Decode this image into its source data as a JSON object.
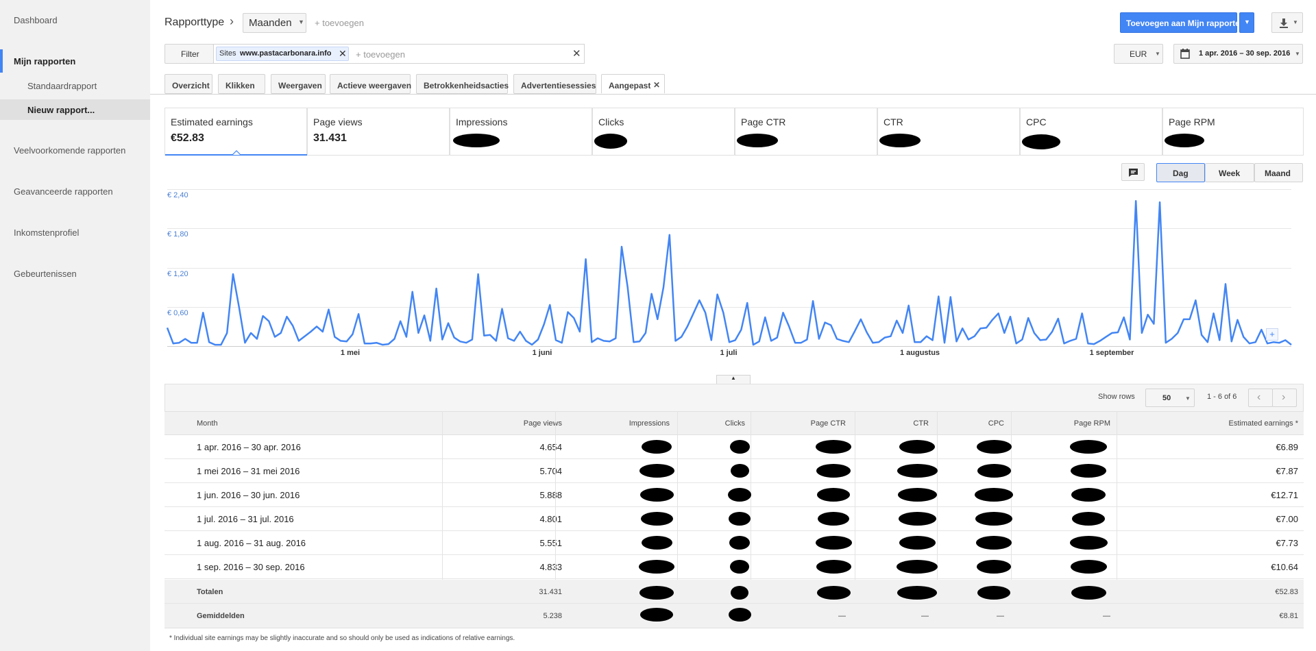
{
  "sidebar": {
    "items": [
      "Dashboard",
      "Mijn rapporten",
      "Standaardrapport",
      "Nieuw rapport...",
      "Veelvoorkomende rapporten",
      "Geavanceerde rapporten",
      "Inkomstenprofiel",
      "Gebeurtenissen"
    ]
  },
  "header": {
    "title": "Rapporttype",
    "breadcrumb_sep": "›",
    "report_type": "Maanden",
    "add_label": "+ toevoegen",
    "add_to_reports_button": "Toevoegen aan Mijn rapporten",
    "filter_button": "Filter",
    "filter_chip_prefix": "Sites",
    "filter_chip_value": "www.pastacarbonara.info",
    "filter_placeholder": "+ toevoegen",
    "currency": "EUR",
    "date_range": "1 apr. 2016 – 30 sep. 2016"
  },
  "tabs": [
    "Overzicht",
    "Klikken",
    "Weergaven",
    "Actieve weergaven",
    "Betrokkenheidsacties",
    "Advertentiesessies",
    "Aangepast"
  ],
  "metrics": [
    {
      "label": "Estimated earnings",
      "value": "€52.83"
    },
    {
      "label": "Page views",
      "value": "31.431"
    },
    {
      "label": "Impressions",
      "value": ""
    },
    {
      "label": "Clicks",
      "value": ""
    },
    {
      "label": "Page CTR",
      "value": ""
    },
    {
      "label": "CTR",
      "value": ""
    },
    {
      "label": "CPC",
      "value": ""
    },
    {
      "label": "Page RPM",
      "value": ""
    }
  ],
  "granularity": {
    "day": "Dag",
    "week": "Week",
    "month": "Maand",
    "selected": "Dag"
  },
  "chart_data": {
    "type": "line",
    "series": [
      {
        "values": [
          0.28,
          0.04,
          0.05,
          0.11,
          0.05,
          0.05,
          0.51,
          0.06,
          0.02,
          0.02,
          0.2,
          1.1,
          0.6,
          0.05,
          0.2,
          0.11,
          0.46,
          0.38,
          0.14,
          0.2,
          0.45,
          0.31,
          0.08,
          0.15,
          0.22,
          0.3,
          0.22,
          0.56,
          0.14,
          0.08,
          0.07,
          0.18,
          0.49,
          0.04,
          0.04,
          0.05,
          0.02,
          0.03,
          0.11,
          0.38,
          0.14,
          0.83,
          0.2,
          0.47,
          0.08,
          0.88,
          0.1,
          0.35,
          0.13,
          0.07,
          0.05,
          0.1,
          1.1,
          0.16,
          0.17,
          0.08,
          0.57,
          0.12,
          0.08,
          0.22,
          0.08,
          0.02,
          0.1,
          0.33,
          0.63,
          0.09,
          0.05,
          0.52,
          0.43,
          0.22,
          1.33,
          0.06,
          0.12,
          0.08,
          0.07,
          0.12,
          1.52,
          0.9,
          0.06,
          0.07,
          0.2,
          0.8,
          0.41,
          0.9,
          1.7,
          0.08,
          0.14,
          0.3,
          0.5,
          0.7,
          0.51,
          0.09,
          0.79,
          0.51,
          0.06,
          0.09,
          0.25,
          0.66,
          0.02,
          0.07,
          0.44,
          0.08,
          0.13,
          0.51,
          0.3,
          0.05,
          0.05,
          0.1,
          0.69,
          0.11,
          0.36,
          0.32,
          0.11,
          0.08,
          0.06,
          0.23,
          0.41,
          0.21,
          0.05,
          0.06,
          0.13,
          0.15,
          0.39,
          0.2,
          0.62,
          0.06,
          0.06,
          0.15,
          0.09,
          0.76,
          0.05,
          0.75,
          0.07,
          0.27,
          0.1,
          0.15,
          0.27,
          0.28,
          0.4,
          0.5,
          0.2,
          0.45,
          0.04,
          0.1,
          0.43,
          0.2,
          0.09,
          0.1,
          0.22,
          0.42,
          0.04,
          0.08,
          0.11,
          0.5,
          0.04,
          0.03,
          0.08,
          0.14,
          0.2,
          0.21,
          0.44,
          0.1,
          2.22,
          0.2,
          0.48,
          0.34,
          2.2,
          0.05,
          0.11,
          0.2,
          0.41,
          0.41,
          0.7,
          0.17,
          0.06,
          0.5,
          0.09,
          0.95,
          0.07,
          0.4,
          0.14,
          0.04,
          0.06,
          0.25,
          0.04,
          0.06,
          0.05,
          0.09,
          0.02
        ]
      }
    ],
    "x_ticks": [
      "1 mei",
      "1 juni",
      "1 juli",
      "1 augustus",
      "1 september"
    ],
    "y_ticks": [
      "€ 0,60",
      "€ 1,20",
      "€ 1,80",
      "€ 2,40"
    ],
    "ylim": [
      0,
      2.4
    ],
    "grid": true
  },
  "table": {
    "show_rows_label": "Show rows",
    "rows_per_page": "50",
    "range_label": "1 - 6 of 6",
    "headers": [
      "Month",
      "Page views",
      "Impressions",
      "Clicks",
      "Page CTR",
      "CTR",
      "CPC",
      "Page RPM",
      "Estimated earnings *"
    ],
    "rows": [
      {
        "month": "1 apr. 2016 – 30 apr. 2016",
        "page_views": "4.654",
        "earnings": "€6.89"
      },
      {
        "month": "1 mei 2016 – 31 mei 2016",
        "page_views": "5.704",
        "earnings": "€7.87"
      },
      {
        "month": "1 jun. 2016 – 30 jun. 2016",
        "page_views": "5.888",
        "earnings": "€12.71"
      },
      {
        "month": "1 jul. 2016 – 31 jul. 2016",
        "page_views": "4.801",
        "earnings": "€7.00"
      },
      {
        "month": "1 aug. 2016 – 31 aug. 2016",
        "page_views": "5.551",
        "earnings": "€7.73"
      },
      {
        "month": "1 sep. 2016 – 30 sep. 2016",
        "page_views": "4.833",
        "earnings": "€10.64"
      }
    ],
    "totals": {
      "label": "Totalen",
      "page_views": "31.431",
      "earnings": "€52.83"
    },
    "averages": {
      "label": "Gemiddelden",
      "page_views": "5.238",
      "page_ctr": "—",
      "ctr": "—",
      "cpc": "—",
      "rpm": "—",
      "earnings": "€8.81"
    },
    "footnote": "* Individual site earnings may be slightly inaccurate and so should only be used as indications of relative earnings."
  },
  "colors": {
    "accent": "#4285f4",
    "line": "#4285f4"
  }
}
